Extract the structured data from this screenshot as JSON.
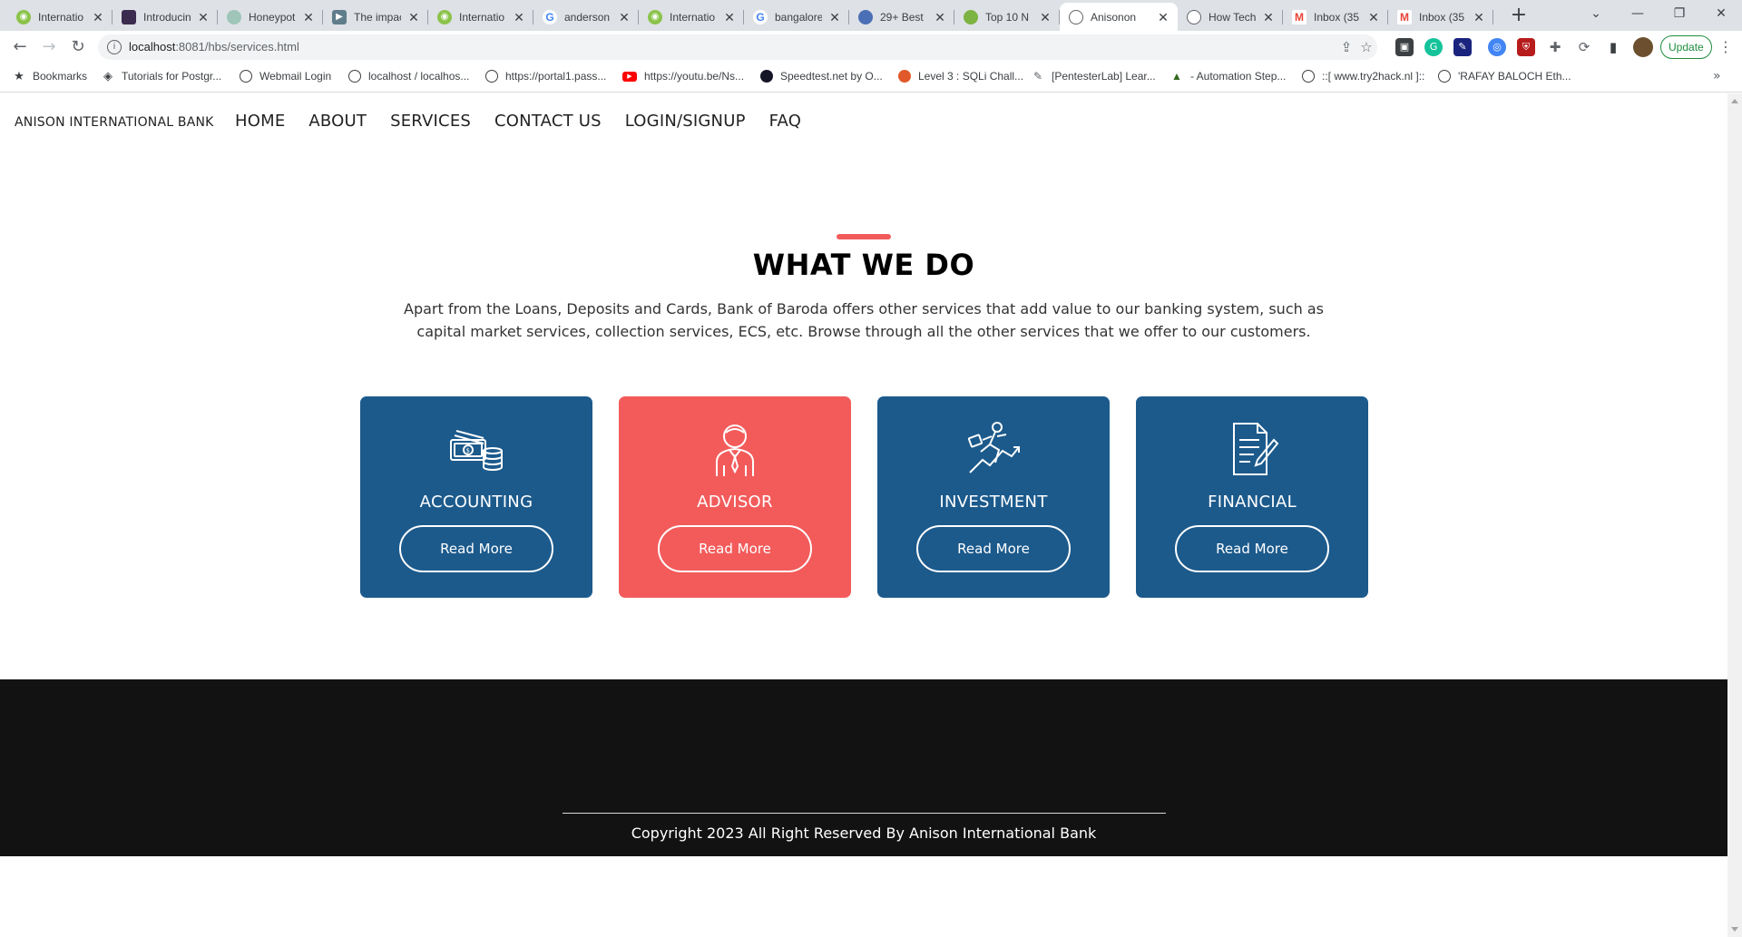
{
  "browser": {
    "tabs": [
      {
        "title": "Internatio",
        "favicon": "globe-green-icon"
      },
      {
        "title": "Introducin",
        "favicon": "app-icon"
      },
      {
        "title": "Honeypot",
        "favicon": "app-icon"
      },
      {
        "title": "The impac",
        "favicon": "arrow-icon"
      },
      {
        "title": "Internatio",
        "favicon": "globe-green-icon"
      },
      {
        "title": "anderson",
        "favicon": "google-icon"
      },
      {
        "title": "Internatio",
        "favicon": "globe-green-icon"
      },
      {
        "title": "bangalore",
        "favicon": "google-icon"
      },
      {
        "title": "29+ Best",
        "favicon": "app-icon"
      },
      {
        "title": "Top 10 N",
        "favicon": "circle-green-icon"
      },
      {
        "title": "Anisonon",
        "favicon": "globe-icon",
        "active": true
      },
      {
        "title": "How Tech",
        "favicon": "globe-icon"
      },
      {
        "title": "Inbox (35",
        "favicon": "gmail-icon"
      },
      {
        "title": "Inbox (35",
        "favicon": "gmail-icon"
      }
    ],
    "new_tab_label": "+",
    "url_host": "localhost",
    "url_path": ":8081/hbs/services.html",
    "update_label": "Update",
    "bookmarks": [
      {
        "label": "Bookmarks",
        "icon": "star-icon"
      },
      {
        "label": "Tutorials for Postgr...",
        "icon": "diamond-icon"
      },
      {
        "label": "Webmail Login",
        "icon": "globe-icon"
      },
      {
        "label": "localhost / localhos...",
        "icon": "globe-icon"
      },
      {
        "label": "https://portal1.pass...",
        "icon": "globe-icon"
      },
      {
        "label": "https://youtu.be/Ns...",
        "icon": "youtube-icon"
      },
      {
        "label": "Speedtest.net by O...",
        "icon": "speedtest-icon"
      },
      {
        "label": "Level 3 : SQLi Chall...",
        "icon": "flag-icon"
      },
      {
        "label": "[PentesterLab] Lear...",
        "icon": "pen-icon"
      },
      {
        "label": "- Automation Step...",
        "icon": "tree-icon"
      },
      {
        "label": "::[ www.try2hack.nl ]::",
        "icon": "globe-icon"
      },
      {
        "label": "'RAFAY BALOCH Eth...",
        "icon": "globe-icon"
      }
    ],
    "colors": {
      "tabstrip": "#dee1e6",
      "update": "#1e8e3e"
    }
  },
  "site": {
    "brand": "ANISON INTERNATIONAL BANK",
    "nav": [
      "HOME",
      "ABOUT",
      "SERVICES",
      "CONTACT US",
      "LOGIN/SIGNUP",
      "FAQ"
    ],
    "section_title": "WHAT WE DO",
    "section_desc": "Apart from the Loans, Deposits and Cards, Bank of Baroda offers other services that add value to our banking system, such as capital market services, collection services, ECS, etc. Browse through all the other services that we offer to our customers.",
    "cards": [
      {
        "name": "ACCOUNTING",
        "button": "Read More",
        "icon": "money-coins-icon",
        "color": "#1c5a8c"
      },
      {
        "name": "ADVISOR",
        "button": "Read More",
        "icon": "advisor-person-icon",
        "color": "#f35b5b"
      },
      {
        "name": "INVESTMENT",
        "button": "Read More",
        "icon": "investment-growth-icon",
        "color": "#1c5a8c"
      },
      {
        "name": "FINANCIAL",
        "button": "Read More",
        "icon": "document-pen-icon",
        "color": "#1c5a8c"
      }
    ],
    "footer_copyright": "Copyright 2023 All Right Reserved By Anison International Bank",
    "colors": {
      "accent": "#f35b5b",
      "card_blue": "#1c5a8c",
      "footer_bg": "#121212"
    }
  }
}
